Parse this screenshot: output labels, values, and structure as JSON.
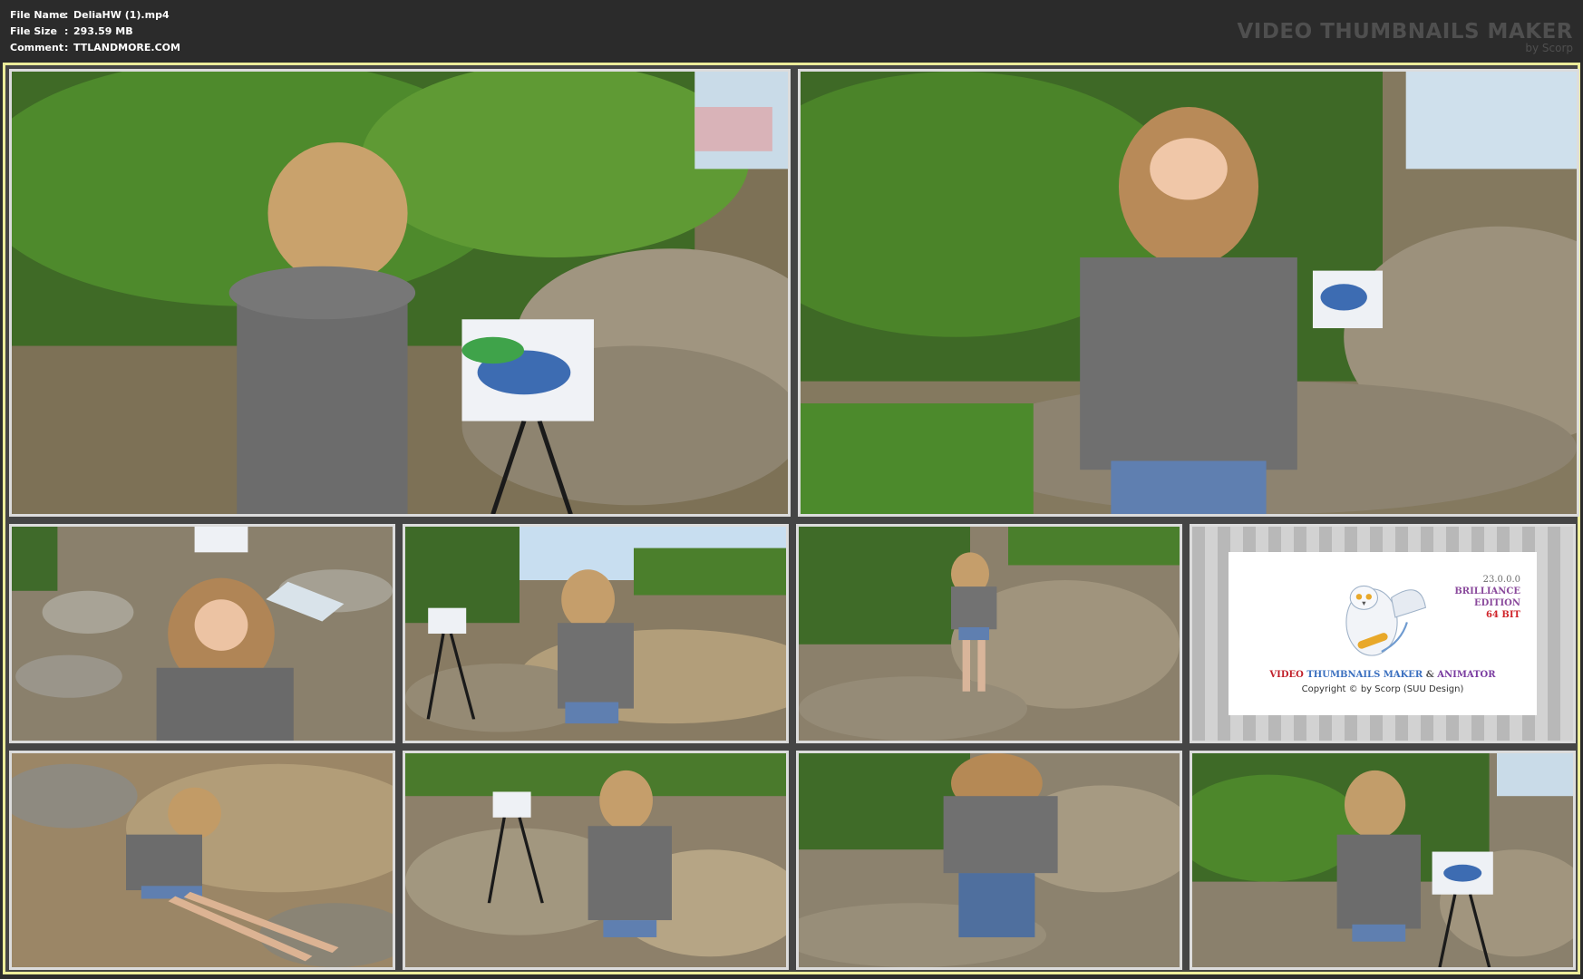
{
  "file_info": {
    "name_label": "File Name",
    "name_value": "DeliaHW (1).mp4",
    "size_label": "File Size",
    "size_value": "293.59 MB",
    "comment_label": "Comment",
    "comment_value": "TTLANDMORE.COM",
    "separator": ":"
  },
  "brand": {
    "title": "VIDEO THUMBNAILS MAKER",
    "subtitle": "by Scorp"
  },
  "splash": {
    "version": "23.0.0.0",
    "edition_line1": "BRILLIANCE",
    "edition_line2": "EDITION",
    "bits": "64 BIT",
    "name_part1": "VIDEO",
    "name_part2": "THUMBNAILS MAKER",
    "name_part3": "&",
    "name_part4": "ANIMATOR",
    "copyright": "Copyright © by Scorp (SUU Design)"
  },
  "colors": {
    "header_bg": "#2b2b2b",
    "sheet_border": "#ecec9a",
    "sheet_bg": "#454545",
    "thumb_border": "#dcdcdc"
  }
}
